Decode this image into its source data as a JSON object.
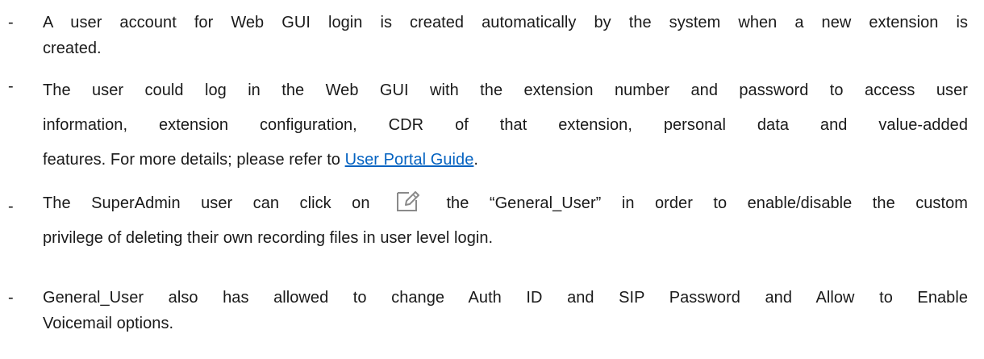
{
  "bullets": [
    {
      "marker": "-",
      "line1": "A user account for Web GUI login is created automatically by the system when a new extension is",
      "line2": "created."
    },
    {
      "marker": "-",
      "line1": "The user could log in the Web GUI with the extension number and password to access user",
      "line2": "information, extension configuration, CDR of that extension, personal data and value-added",
      "line3_pre": "features. For more details; please refer to ",
      "link": "User Portal Guide",
      "line3_post": "."
    },
    {
      "marker": "-",
      "line1_pre": "The SuperAdmin user can click on",
      "icon": "edit-icon",
      "line1_post": "the “General_User” in order to enable/disable the custom",
      "line2": "privilege of deleting their own recording files in user level login."
    },
    {
      "marker": "-",
      "line1": "General_User also has allowed to change Auth ID and SIP Password and Allow to Enable",
      "line2": "Voicemail options."
    }
  ]
}
